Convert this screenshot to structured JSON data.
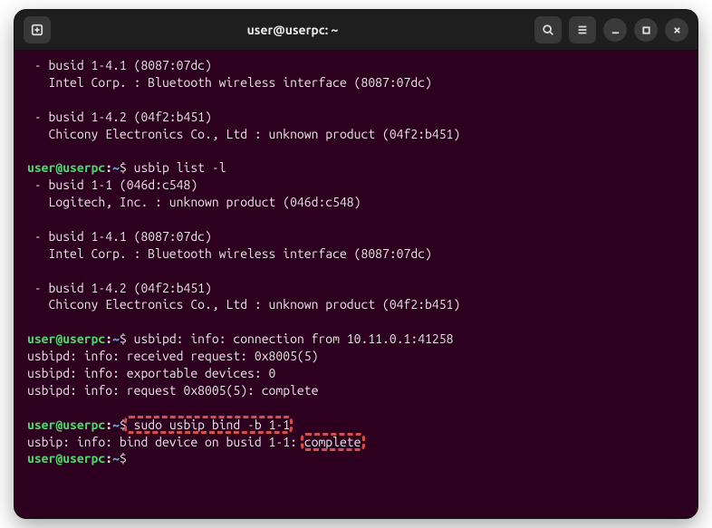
{
  "window": {
    "title": "user@userpc: ~"
  },
  "prompt": {
    "userhost": "user@userpc",
    "colon": ":",
    "path": "~",
    "dollar": "$"
  },
  "lines": {
    "l01": " - busid 1-4.1 (8087:07dc)",
    "l02": "   Intel Corp. : Bluetooth wireless interface (8087:07dc)",
    "l03": "",
    "l04": " - busid 1-4.2 (04f2:b451)",
    "l05": "   Chicony Electronics Co., Ltd : unknown product (04f2:b451)",
    "l06": "",
    "cmd1": " usbip list -l",
    "l07": " - busid 1-1 (046d:c548)",
    "l08": "   Logitech, Inc. : unknown product (046d:c548)",
    "l09": "",
    "l10": " - busid 1-4.1 (8087:07dc)",
    "l11": "   Intel Corp. : Bluetooth wireless interface (8087:07dc)",
    "l12": "",
    "l13": " - busid 1-4.2 (04f2:b451)",
    "l14": "   Chicony Electronics Co., Ltd : unknown product (04f2:b451)",
    "l15": "",
    "cmd2_tail": " usbipd: info: connection from 10.11.0.1:41258",
    "l16": "usbipd: info: received request: 0x8005(5)",
    "l17": "usbipd: info: exportable devices: 0",
    "l18": "usbipd: info: request 0x8005(5): complete",
    "l19": "",
    "cmd3": " sudo usbip bind -b 1-1",
    "l20a": "usbip: info: bind device on busid 1-1: ",
    "l20b": "complete"
  }
}
